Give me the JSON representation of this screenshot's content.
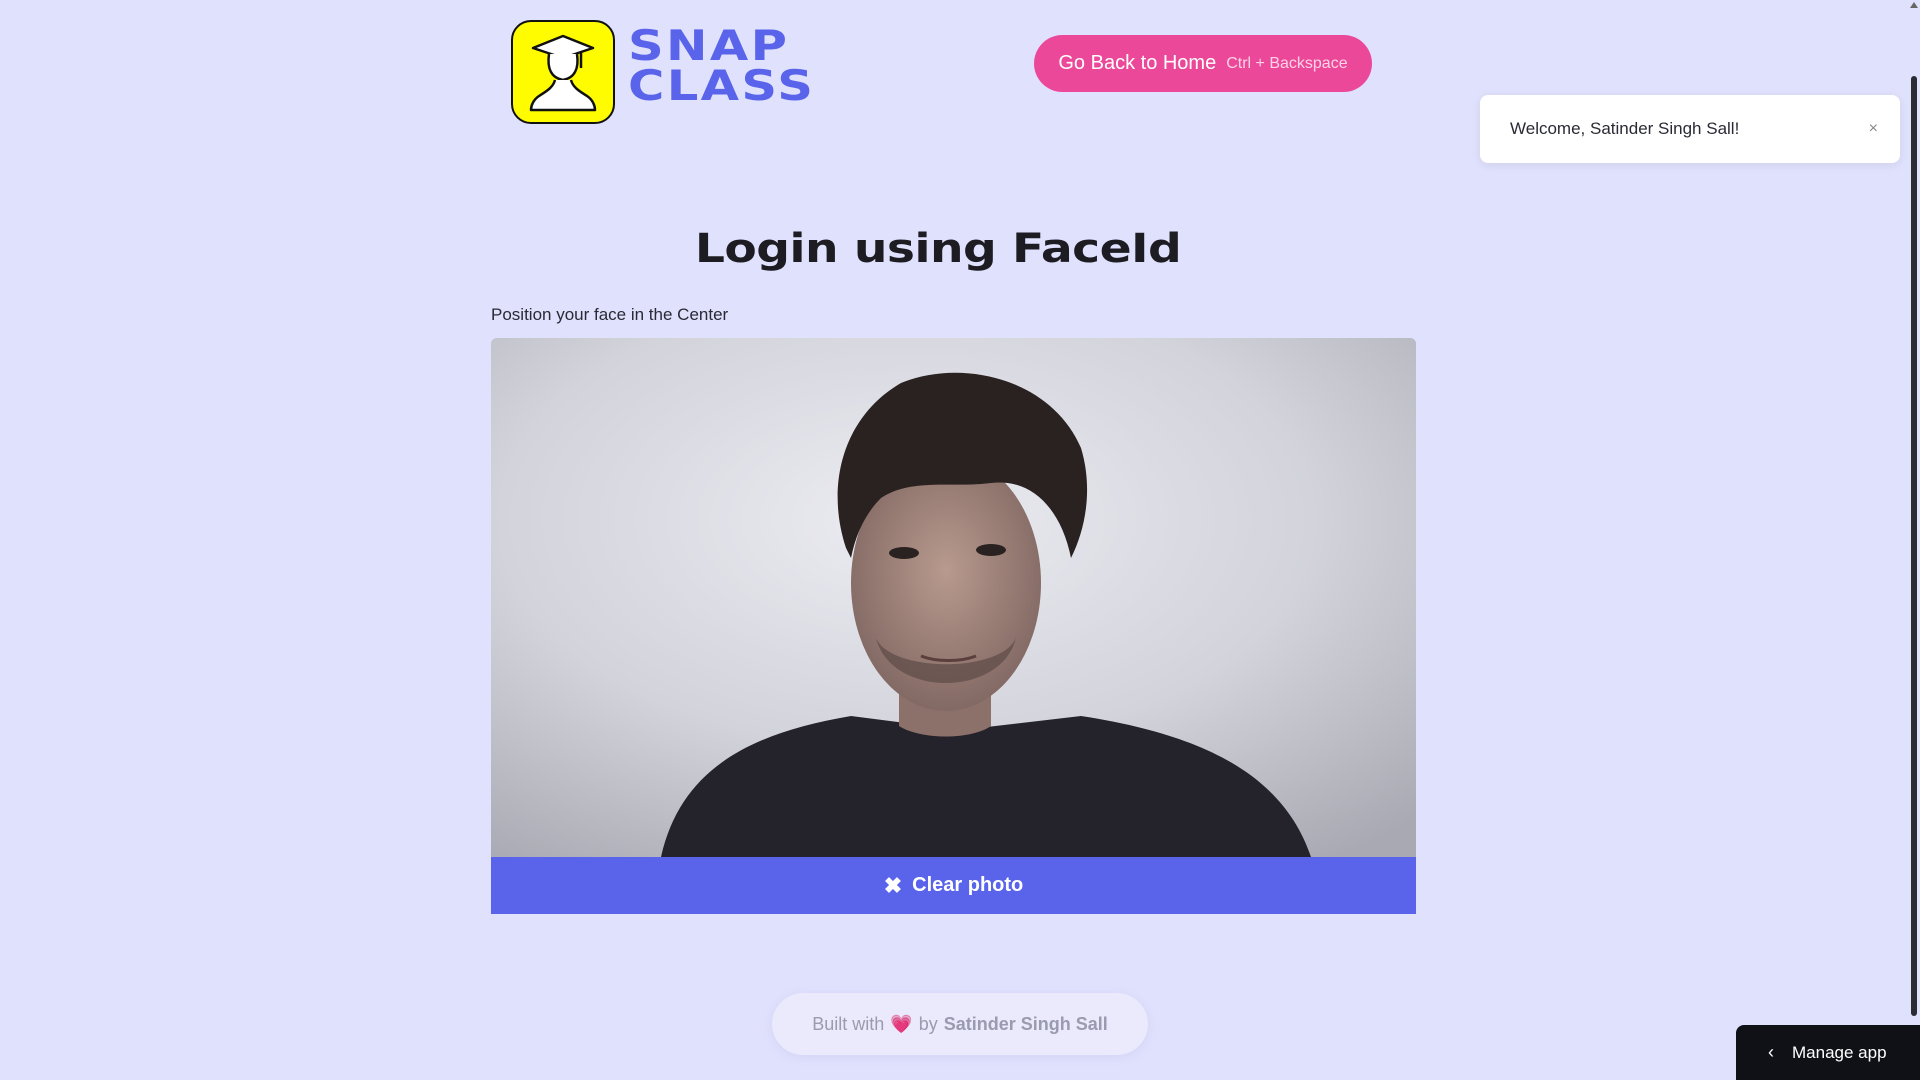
{
  "header": {
    "brand_line1": "SNAP",
    "brand_line2": "CLASS",
    "logo_icon": "graduate-silhouette-icon",
    "home_button_label": "Go Back to Home",
    "home_button_shortcut": "Ctrl + Backspace"
  },
  "toast": {
    "message": "Welcome, Satinder Singh Sall!",
    "close_symbol": "×"
  },
  "main": {
    "title": "Login using FaceId",
    "instruction": "Position your face in the Center",
    "clear_button_icon": "✖",
    "clear_button_label": "Clear photo"
  },
  "footer": {
    "prefix": "Built with",
    "heart": "💗",
    "by": "by",
    "author": "Satinder Singh Sall"
  },
  "manage_app": {
    "chevron": "‹",
    "label": "Manage app"
  },
  "colors": {
    "background": "#e0e1fd",
    "brand": "#5964eb",
    "logo_yellow": "#fffc00",
    "home_button": "#ec4899",
    "clear_button": "#5964eb"
  }
}
